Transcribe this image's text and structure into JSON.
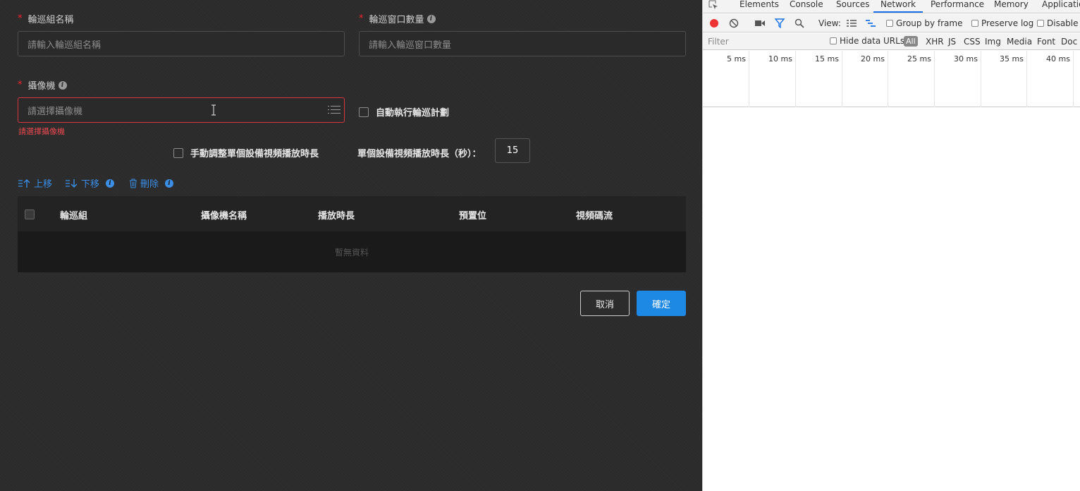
{
  "form": {
    "group_name_label": "輪巡組名稱",
    "group_name_placeholder": "請輸入輪巡組名稱",
    "window_count_label": "輪巡窗口數量",
    "window_count_placeholder": "請輸入輪巡窗口數量",
    "camera_label": "攝像機",
    "camera_placeholder": "請選擇攝像機",
    "camera_error": "請選擇攝像機",
    "auto_exec_label": "自動執行輪巡計劃",
    "manual_adjust_label": "手動調整單個設備視頻播放時長",
    "duration_label": "單個設備視頻播放時長（秒）：",
    "duration_value": "15",
    "required_mark": "*"
  },
  "toolbar": {
    "move_up": "上移",
    "move_down": "下移",
    "delete": "刪除"
  },
  "table": {
    "columns": [
      "輪巡組",
      "攝像機名稱",
      "播放時長",
      "預置位",
      "視頻碼流"
    ],
    "empty_text": "暫無資料"
  },
  "buttons": {
    "cancel": "取消",
    "ok": "確定"
  },
  "devtools": {
    "tabs": [
      "Elements",
      "Console",
      "Sources",
      "Network",
      "Performance",
      "Memory",
      "Applicatio"
    ],
    "active_tab": "Network",
    "view_label": "View:",
    "group_by_frame": "Group by frame",
    "preserve_log": "Preserve log",
    "disable": "Disable",
    "filter_placeholder": "Filter",
    "hide_data_urls": "Hide data URLs",
    "types": [
      "All",
      "XHR",
      "JS",
      "CSS",
      "Img",
      "Media",
      "Font",
      "Doc"
    ],
    "timeline_ticks": [
      "5 ms",
      "10 ms",
      "15 ms",
      "20 ms",
      "25 ms",
      "30 ms",
      "35 ms",
      "40 ms"
    ]
  },
  "colors": {
    "accent": "#1e88e5",
    "error": "#e5484d",
    "required": "#f5222d"
  }
}
